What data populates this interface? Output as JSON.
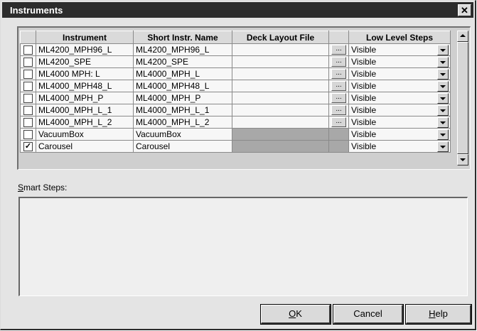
{
  "window": {
    "title": "Instruments",
    "close_glyph": "✕"
  },
  "grid": {
    "columns": [
      "",
      "Instrument",
      "Short Instr. Name",
      "Deck Layout File",
      "",
      "Low Level Steps"
    ],
    "rows": [
      {
        "checked": false,
        "instrument": "ML4200_MPH96_L",
        "short_name": "ML4200_MPH96_L",
        "deck_layout": "",
        "browse": true,
        "low_level": "Visible"
      },
      {
        "checked": false,
        "instrument": "ML4200_SPE",
        "short_name": "ML4200_SPE",
        "deck_layout": "",
        "browse": true,
        "low_level": "Visible"
      },
      {
        "checked": false,
        "instrument": "ML4000 MPH: L",
        "short_name": "ML4000_MPH_L",
        "deck_layout": "",
        "browse": true,
        "low_level": "Visible"
      },
      {
        "checked": false,
        "instrument": "ML4000_MPH48_L",
        "short_name": "ML4000_MPH48_L",
        "deck_layout": "",
        "browse": true,
        "low_level": "Visible"
      },
      {
        "checked": false,
        "instrument": "ML4000_MPH_P",
        "short_name": "ML4000_MPH_P",
        "deck_layout": "",
        "browse": true,
        "low_level": "Visible"
      },
      {
        "checked": false,
        "instrument": "ML4000_MPH_L_1",
        "short_name": "ML4000_MPH_L_1",
        "deck_layout": "",
        "browse": true,
        "low_level": "Visible"
      },
      {
        "checked": false,
        "instrument": "ML4000_MPH_L_2",
        "short_name": "ML4000_MPH_L_2",
        "deck_layout": "",
        "browse": true,
        "low_level": "Visible"
      },
      {
        "checked": false,
        "instrument": "VacuumBox",
        "short_name": "VacuumBox",
        "deck_layout": "",
        "browse": false,
        "low_level": "Visible"
      },
      {
        "checked": true,
        "instrument": "Carousel",
        "short_name": "Carousel",
        "deck_layout": "",
        "browse": false,
        "low_level": "Visible"
      }
    ],
    "browse_label": "...",
    "check_glyph": "✓"
  },
  "smart_steps": {
    "label_mnemonic": "S",
    "label_rest": "mart Steps:"
  },
  "buttons": {
    "ok_mnemonic": "O",
    "ok_rest": "K",
    "cancel": "Cancel",
    "help_mnemonic": "H",
    "help_rest": "elp"
  }
}
